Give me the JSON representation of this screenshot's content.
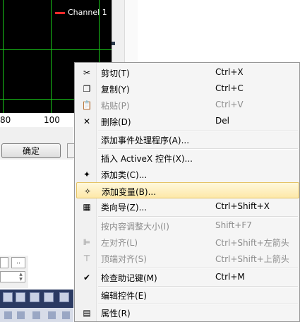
{
  "chart": {
    "legend_label": "Channel 1",
    "legend_color": "#ff2a2a",
    "grid_color": "#18c418",
    "x_ticks": [
      "80",
      "100"
    ]
  },
  "dialog": {
    "ok_label": "确定",
    "field_small": ".."
  },
  "menu": {
    "items": [
      {
        "icon": "scissors-icon",
        "label": "剪切(T)",
        "shortcut": "Ctrl+X",
        "enabled": true
      },
      {
        "icon": "copy-icon",
        "label": "复制(Y)",
        "shortcut": "Ctrl+C",
        "enabled": true
      },
      {
        "icon": "paste-icon",
        "label": "粘贴(P)",
        "shortcut": "Ctrl+V",
        "enabled": false
      },
      {
        "icon": "delete-icon",
        "label": "删除(D)",
        "shortcut": "Del",
        "enabled": true
      },
      {
        "icon": "",
        "label": "添加事件处理程序(A)...",
        "shortcut": "",
        "enabled": true
      },
      {
        "icon": "",
        "label": "插入 ActiveX 控件(X)...",
        "shortcut": "",
        "enabled": true
      },
      {
        "icon": "add-class-icon",
        "label": "添加类(C)...",
        "shortcut": "",
        "enabled": true
      },
      {
        "icon": "add-variable-icon",
        "label": "添加变量(B)...",
        "shortcut": "",
        "enabled": true
      },
      {
        "icon": "class-wizard-icon",
        "label": "类向导(Z)...",
        "shortcut": "Ctrl+Shift+X",
        "enabled": true
      },
      {
        "icon": "",
        "label": "按内容调整大小(I)",
        "shortcut": "Shift+F7",
        "enabled": false
      },
      {
        "icon": "align-left-icon",
        "label": "左对齐(L)",
        "shortcut": "Ctrl+Shift+左箭头",
        "enabled": false
      },
      {
        "icon": "align-top-icon",
        "label": "顶端对齐(S)",
        "shortcut": "Ctrl+Shift+上箭头",
        "enabled": false
      },
      {
        "icon": "check-mnemonics-icon",
        "label": "检查助记键(M)",
        "shortcut": "Ctrl+M",
        "enabled": true
      },
      {
        "icon": "",
        "label": "编辑控件(E)",
        "shortcut": "",
        "enabled": true
      },
      {
        "icon": "properties-icon",
        "label": "属性(R)",
        "shortcut": "",
        "enabled": true
      }
    ]
  }
}
